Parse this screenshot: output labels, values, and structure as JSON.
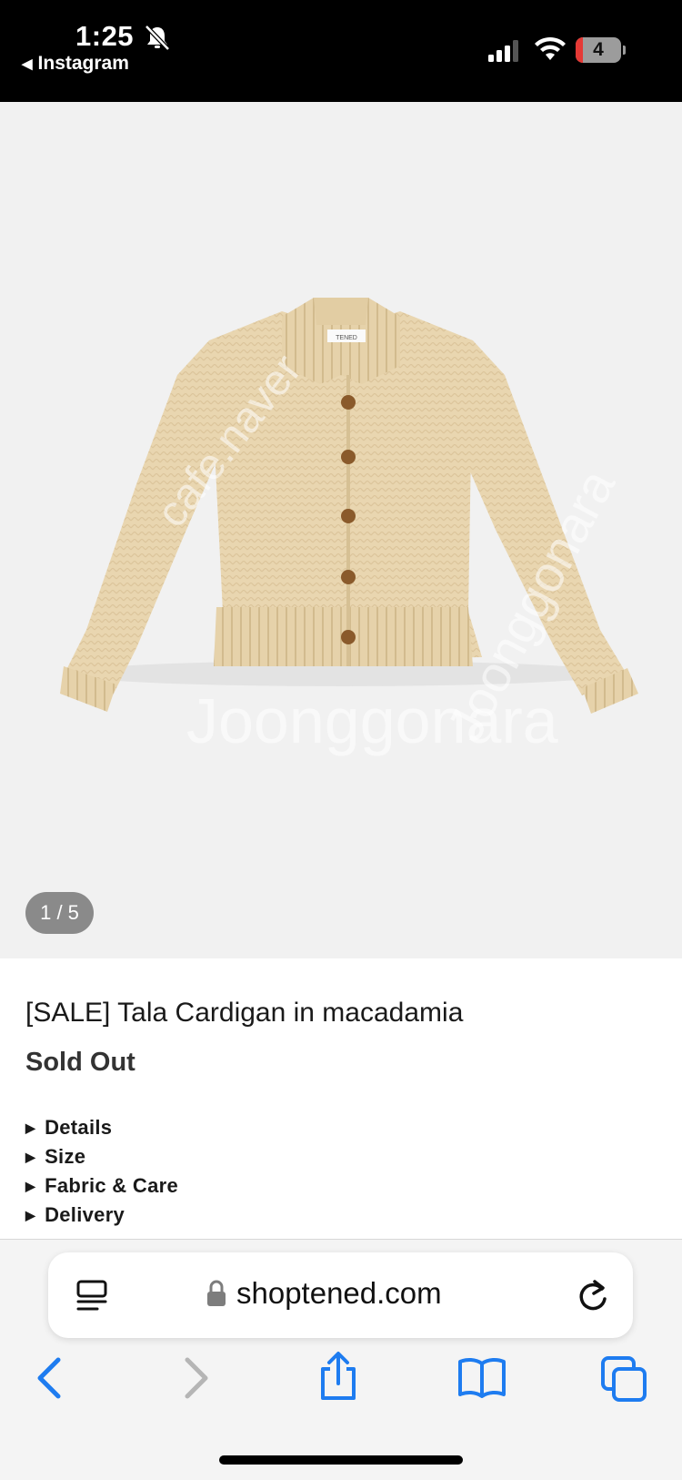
{
  "status_bar": {
    "time": "1:25",
    "back_app": "Instagram",
    "battery_level": "4",
    "icons": [
      "bell-slash-icon",
      "cellular-signal-icon",
      "wifi-icon",
      "battery-icon"
    ]
  },
  "product": {
    "image_counter": "1 / 5",
    "title": "[SALE] Tala Cardigan in macadamia",
    "status": "Sold Out",
    "sections": [
      "Details",
      "Size",
      "Fabric & Care",
      "Delivery"
    ],
    "label_tag": "TENED"
  },
  "browser": {
    "url": "shoptened.com",
    "toolbar_icons": [
      "back-arrow-icon",
      "forward-arrow-icon",
      "share-icon",
      "bookmarks-icon",
      "tabs-icon"
    ],
    "accent_color": "#1e7cf0"
  },
  "watermarks": [
    "Joonggonara",
    "cafe.naver",
    "Joonggonara"
  ]
}
